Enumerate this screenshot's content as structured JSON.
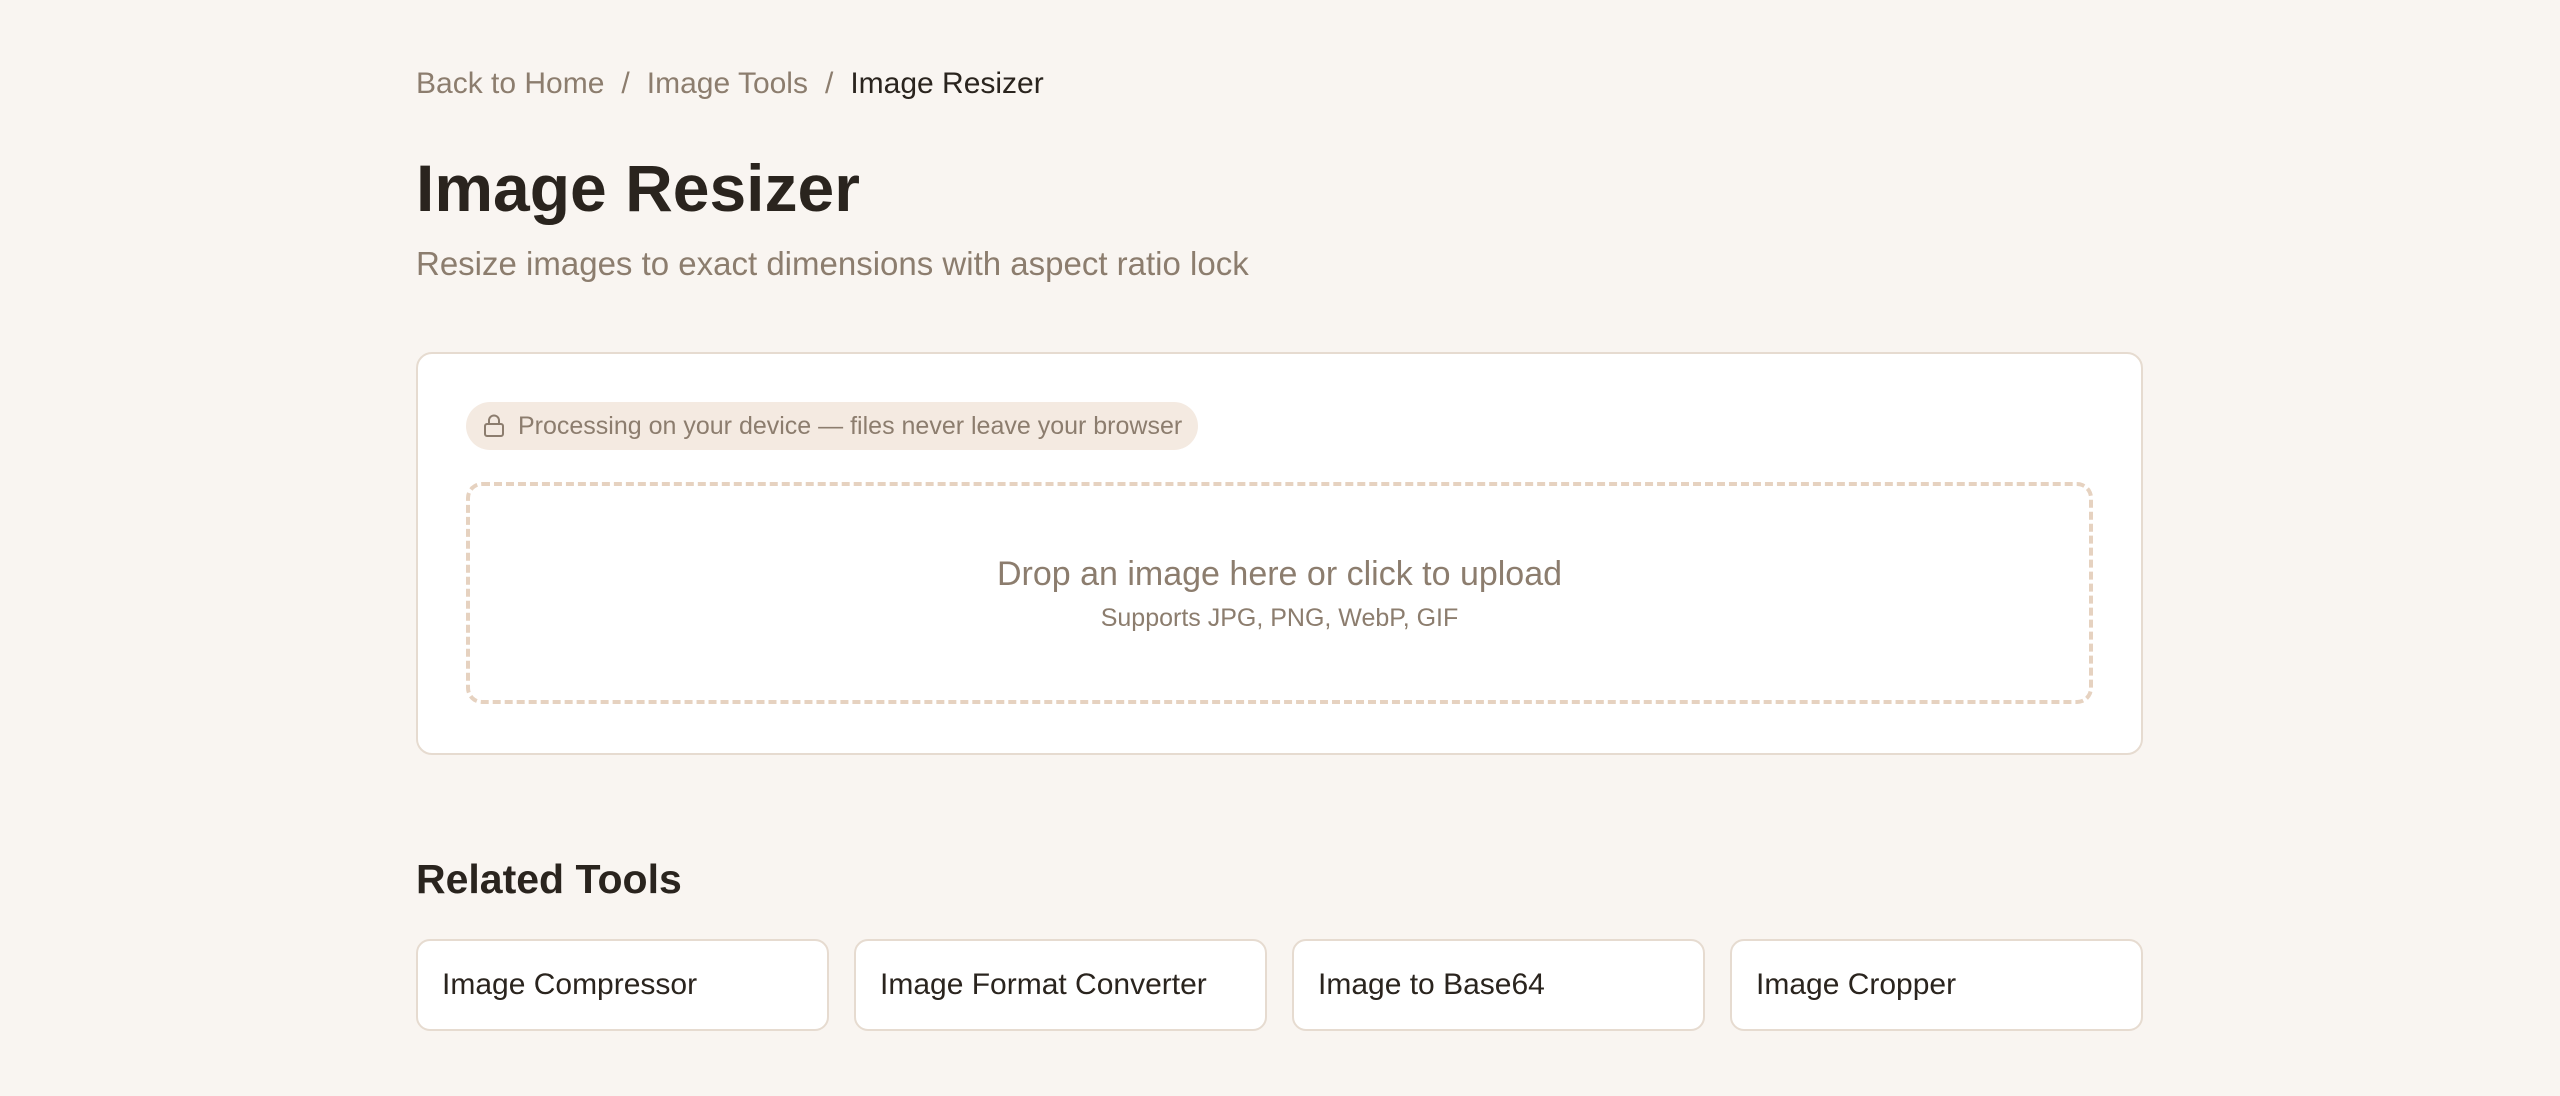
{
  "breadcrumb": {
    "home": "Back to Home",
    "separator": "/",
    "category": "Image Tools",
    "current": "Image Resizer"
  },
  "page": {
    "title": "Image Resizer",
    "subtitle": "Resize images to exact dimensions with aspect ratio lock"
  },
  "tool": {
    "privacy_badge": "Processing on your device — files never leave your browser",
    "privacy_icon": "lock-icon",
    "dropzone_title": "Drop an image here or click to upload",
    "dropzone_hint": "Supports JPG, PNG, WebP, GIF"
  },
  "related": {
    "heading": "Related Tools",
    "items": [
      {
        "label": "Image Compressor"
      },
      {
        "label": "Image Format Converter"
      },
      {
        "label": "Image to Base64"
      },
      {
        "label": "Image Cropper"
      }
    ]
  },
  "colors": {
    "background": "#f9f5f1",
    "text_primary": "#2a241e",
    "text_muted": "#8c7d6e",
    "border": "#e6dbd0",
    "badge_bg": "#f4eae1",
    "dropzone_border": "#e6d2c0"
  }
}
